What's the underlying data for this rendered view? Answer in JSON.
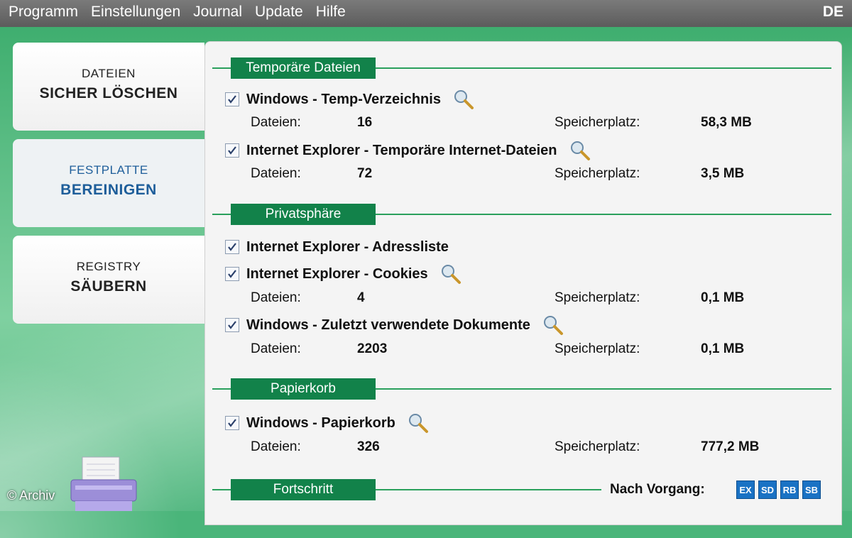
{
  "menubar": {
    "items": [
      "Programm",
      "Einstellungen",
      "Journal",
      "Update",
      "Hilfe"
    ],
    "language": "DE"
  },
  "nav": [
    {
      "line1": "DATEIEN",
      "line2": "SICHER LÖSCHEN"
    },
    {
      "line1": "FESTPLATTE",
      "line2": "BEREINIGEN"
    },
    {
      "line1": "REGISTRY",
      "line2": "SÄUBERN"
    }
  ],
  "sections": {
    "temp": "Temporäre Dateien",
    "privacy": "Privatsphäre",
    "recycle": "Papierkorb",
    "progress": "Fortschritt"
  },
  "labels": {
    "files": "Dateien:",
    "space": "Speicherplatz:"
  },
  "items": [
    {
      "title": "Windows - Temp-Verzeichnis",
      "files": "16",
      "space": "58,3 MB"
    },
    {
      "title": "Internet Explorer - Temporäre Internet-Dateien",
      "files": "72",
      "space": "3,5 MB"
    },
    {
      "title": "Internet Explorer - Adressliste"
    },
    {
      "title": "Internet Explorer - Cookies",
      "files": "4",
      "space": "0,1 MB"
    },
    {
      "title": "Windows - Zuletzt verwendete Dokumente",
      "files": "2203",
      "space": "0,1 MB"
    },
    {
      "title": "Windows - Papierkorb",
      "files": "326",
      "space": "777,2 MB"
    }
  ],
  "after_process": {
    "label": "Nach Vorgang:",
    "buttons": [
      "EX",
      "SD",
      "RB",
      "SB"
    ]
  },
  "watermark": "© Archiv",
  "colors": {
    "accent_green": "#12824a",
    "active_nav_blue": "#1e5e9a",
    "action_blue": "#1a72c4"
  }
}
